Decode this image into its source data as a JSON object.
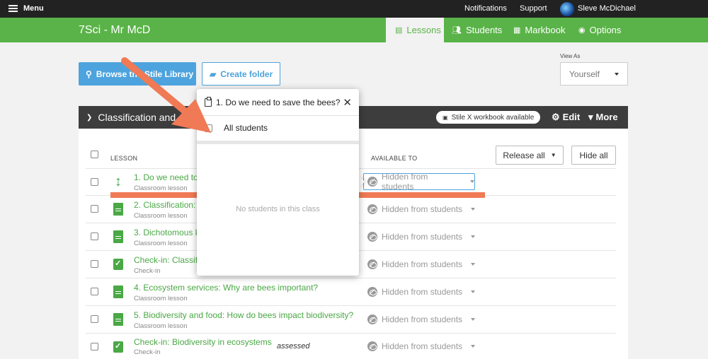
{
  "topbar": {
    "menu_label": "Menu",
    "notifications_label": "Notifications",
    "support_label": "Support",
    "user_name": "Sleve McDichael"
  },
  "greenbar": {
    "class_title": "7Sci - Mr McD",
    "tabs": [
      {
        "label": "Lessons",
        "icon": "document-icon",
        "active": true
      },
      {
        "label": "Students",
        "icon": "students-icon",
        "active": false
      },
      {
        "label": "Markbook",
        "icon": "grid-icon",
        "active": false
      },
      {
        "label": "Options",
        "icon": "chevron-circle-icon",
        "active": false
      }
    ]
  },
  "toolbar": {
    "library_label": "Browse the Stile Library",
    "folder_label": "Create folder",
    "view_as_label": "View As",
    "view_as_value": "Yourself"
  },
  "section": {
    "title": "Classification and",
    "workbook_badge": "Stile X workbook available",
    "edit_label": "Edit",
    "more_label": "More"
  },
  "table": {
    "col_lesson": "LESSON",
    "col_available": "AVAILABLE TO",
    "release_all_label": "Release all",
    "hide_all_label": "Hide all",
    "rows": [
      {
        "title": "1. Do we need to",
        "subtitle": "Classroom lesson",
        "icon": "reorder-arrow-icon",
        "status": "Hidden from students",
        "assessed": ""
      },
      {
        "title": "2. Classification: A",
        "subtitle": "Classroom lesson",
        "icon": "document-icon",
        "status": "Hidden from students",
        "assessed": ""
      },
      {
        "title": "3. Dichotomous k",
        "subtitle": "Classroom lesson",
        "icon": "document-icon",
        "status": "Hidden from students",
        "assessed": ""
      },
      {
        "title": "Check-in: Classific",
        "subtitle": "Check-in",
        "icon": "check-in-icon",
        "status": "Hidden from students",
        "assessed": ""
      },
      {
        "title": "4. Ecosystem services: Why are bees important?",
        "subtitle": "Classroom lesson",
        "icon": "document-icon",
        "status": "Hidden from students",
        "assessed": ""
      },
      {
        "title": "5. Biodiversity and food: How do bees impact biodiversity?",
        "subtitle": "Classroom lesson",
        "icon": "document-icon",
        "status": "Hidden from students",
        "assessed": ""
      },
      {
        "title": "Check-in: Biodiversity in ecosystems",
        "subtitle": "Check-in",
        "icon": "check-in-icon",
        "status": "Hidden from students",
        "assessed": "assessed"
      }
    ]
  },
  "popup": {
    "title": "1. Do we need to save the bees?",
    "all_students_label": "All students",
    "empty_message": "No students in this class"
  },
  "annotation": {
    "color": "#ef7a55"
  }
}
